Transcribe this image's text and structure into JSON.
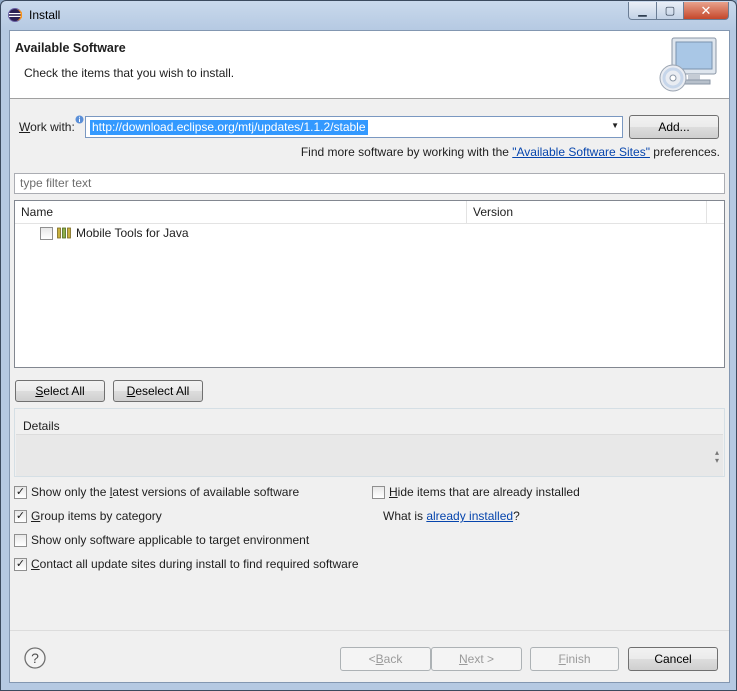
{
  "window": {
    "title": "Install"
  },
  "header": {
    "title": "Available Software",
    "subtitle": "Check the items that you wish to install."
  },
  "work_with": {
    "label_accel": "W",
    "label_rest": "ork with:",
    "value": "http://download.eclipse.org/mtj/updates/1.1.2/stable",
    "add_label": "Add..."
  },
  "find_more": {
    "prefix": "Find more software by working with the ",
    "link": "\"Available Software Sites\"",
    "suffix": " preferences."
  },
  "filter": {
    "placeholder": "type filter text"
  },
  "table": {
    "columns": [
      "Name",
      "Version"
    ],
    "rows": [
      {
        "name": "Mobile Tools for Java",
        "version": "",
        "checked": false
      }
    ]
  },
  "buttons": {
    "select_all_accel": "S",
    "select_all_rest": "elect All",
    "deselect_all_accel": "D",
    "deselect_all_rest": "eselect All"
  },
  "details": {
    "title": "Details"
  },
  "options": {
    "latest": {
      "pre": "Show only the ",
      "accel": "l",
      "post": "atest versions of available software",
      "checked": true
    },
    "group": {
      "pre": "",
      "accel": "G",
      "post": "roup items by category",
      "checked": true
    },
    "applicable": {
      "pre": "Show only software applicable to target environment",
      "accel": "",
      "post": "",
      "checked": false
    },
    "contact": {
      "pre": "",
      "accel": "C",
      "post": "ontact all update sites during install to find required software",
      "checked": true
    },
    "hide": {
      "pre": "",
      "accel": "H",
      "post": "ide items that are already installed",
      "checked": false
    }
  },
  "what_is": {
    "prefix": "What is ",
    "link": "already installed",
    "suffix": "?"
  },
  "footer": {
    "back_pre": "< ",
    "back_accel": "B",
    "back_post": "ack",
    "next_accel": "N",
    "next_post": "ext >",
    "finish_accel": "F",
    "finish_post": "inish",
    "cancel": "Cancel"
  },
  "colors": {
    "accent": "#3399ff",
    "link": "#0645ad"
  }
}
